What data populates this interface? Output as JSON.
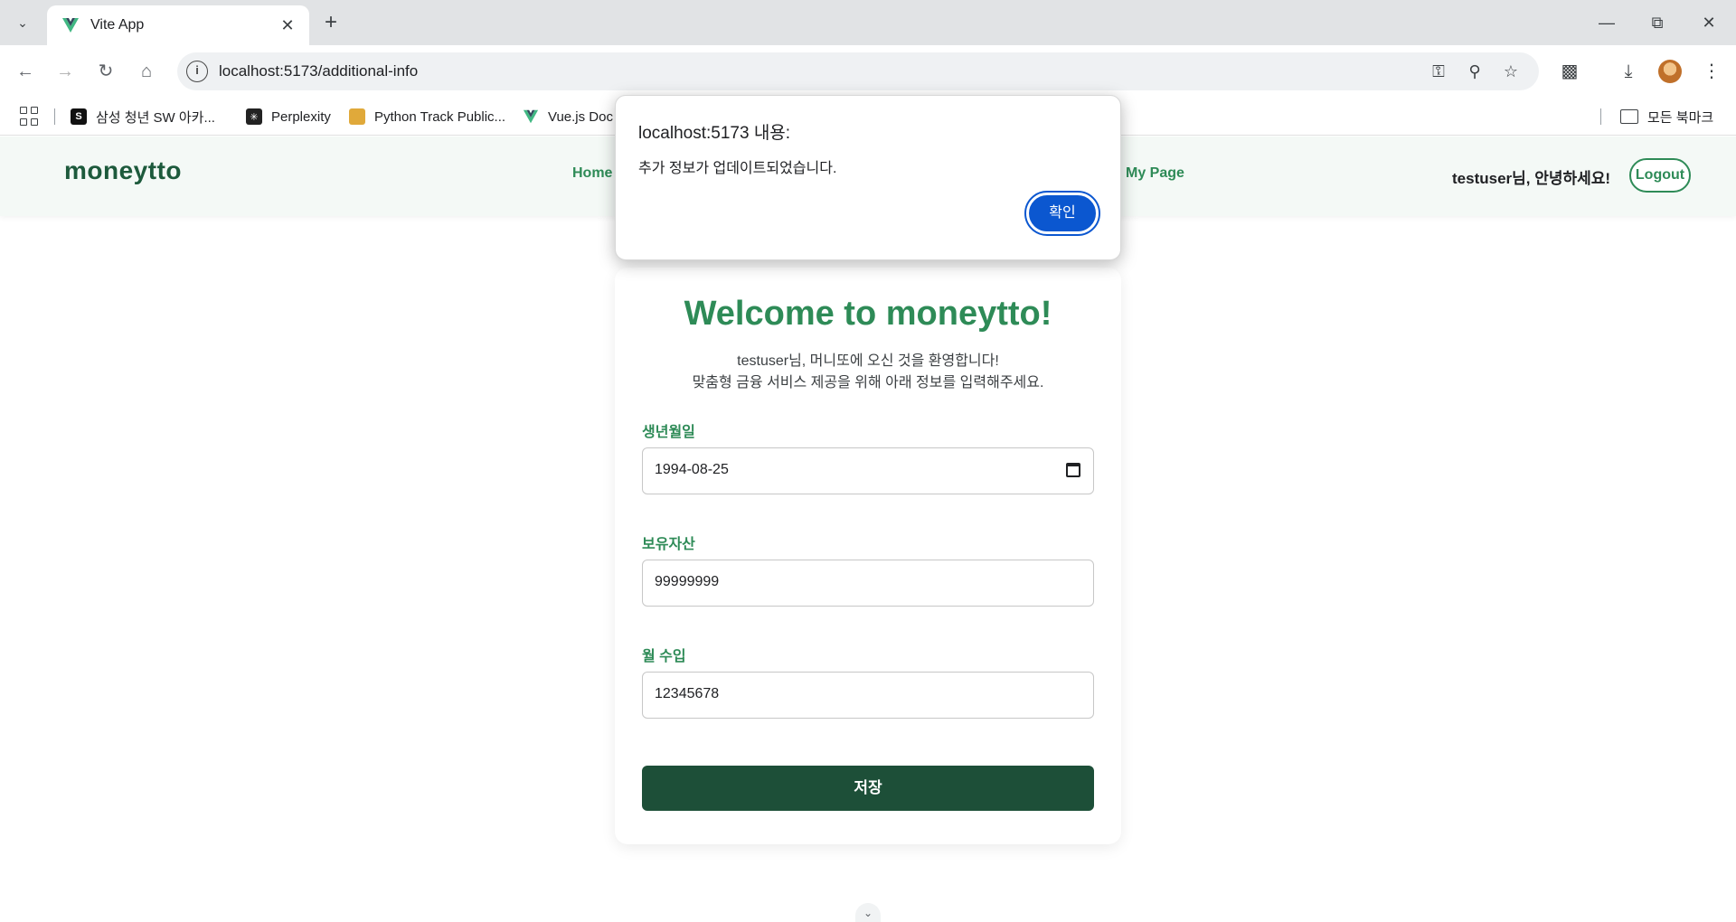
{
  "browser": {
    "tab_title": "Vite App",
    "url": "localhost:5173/additional-info",
    "bookmarks": [
      {
        "label": "삼성 청년 SW 아카..."
      },
      {
        "label": "Perplexity"
      },
      {
        "label": "Python Track Public..."
      },
      {
        "label": "Vue.js Doc"
      }
    ],
    "all_bookmarks_label": "모든 북마크"
  },
  "site": {
    "brand": "moneytto",
    "nav": [
      {
        "label": "Home"
      },
      {
        "label": "My Page"
      }
    ],
    "greeting": "testuser님, 안녕하세요!",
    "logout_label": "Logout"
  },
  "form": {
    "title": "Welcome to moneytto!",
    "subtitle_line1": "testuser님, 머니또에 오신 것을 환영합니다!",
    "subtitle_line2": "맞춤형 금융 서비스 제공을 위해 아래 정보를 입력해주세요.",
    "birth_label": "생년월일",
    "birth_value": "1994-08-25",
    "assets_label": "보유자산",
    "assets_value": "99999999",
    "income_label": "월 수입",
    "income_value": "12345678",
    "save_label": "저장"
  },
  "dialog": {
    "origin": "localhost:5173 내용:",
    "message": "추가 정보가 업데이트되었습니다.",
    "ok_label": "확인"
  },
  "colors": {
    "brand_green": "#2e8b57",
    "dark_green": "#1d4f38",
    "dialog_button": "#0b57d0"
  }
}
